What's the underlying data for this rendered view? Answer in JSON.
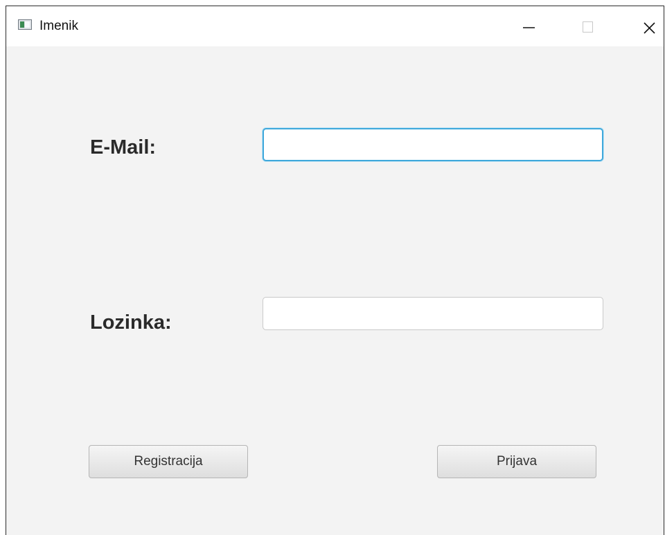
{
  "window": {
    "title": "Imenik",
    "icon": "app-window-icon",
    "controls": [
      "minimize-icon",
      "maximize-icon",
      "close-icon"
    ]
  },
  "form": {
    "email_label": "E-Mail:",
    "email_value": "",
    "password_label": "Lozinka:",
    "password_value": ""
  },
  "buttons": {
    "register_label": "Registracija",
    "login_label": "Prijava"
  },
  "colors": {
    "background": "#f3f3f3",
    "focus_border": "#3fa8db",
    "titlebar": "#ffffff"
  }
}
